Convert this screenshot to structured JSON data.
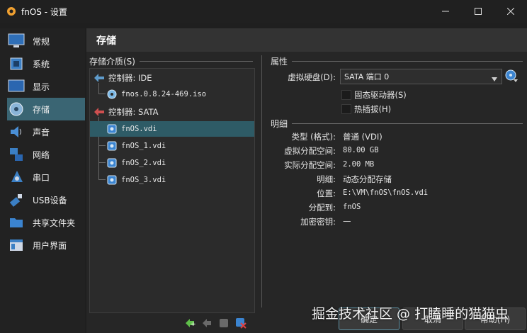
{
  "window": {
    "title": "fnOS - 设置"
  },
  "sidebar": {
    "items": [
      {
        "label": "常规"
      },
      {
        "label": "系统"
      },
      {
        "label": "显示"
      },
      {
        "label": "存储"
      },
      {
        "label": "声音"
      },
      {
        "label": "网络"
      },
      {
        "label": "串口"
      },
      {
        "label": "USB设备"
      },
      {
        "label": "共享文件夹"
      },
      {
        "label": "用户界面"
      }
    ],
    "selected": "存储"
  },
  "page": {
    "title": "存储"
  },
  "storage_tree": {
    "title": "存储介质(S)",
    "controllers": [
      {
        "label": "控制器: IDE",
        "items": [
          {
            "label": "fnos.0.8.24-469.iso"
          }
        ]
      },
      {
        "label": "控制器: SATA",
        "items": [
          {
            "label": "fnOS.vdi"
          },
          {
            "label": "fnOS_1.vdi"
          },
          {
            "label": "fnOS_2.vdi"
          },
          {
            "label": "fnOS_3.vdi"
          }
        ]
      }
    ],
    "selected": "fnOS.vdi"
  },
  "attributes": {
    "title": "属性",
    "hard_disk_label": "虚拟硬盘(D):",
    "hard_disk_value": "SATA 端口 0",
    "solid_state_label": "固态驱动器(S)",
    "solid_state_checked": false,
    "hot_plug_label": "热插拔(H)",
    "hot_plug_checked": false
  },
  "details": {
    "title": "明细",
    "rows": [
      {
        "label": "类型 (格式):",
        "value": "普通 (VDI)"
      },
      {
        "label": "虚拟分配空间:",
        "value": "80.00 GB"
      },
      {
        "label": "实际分配空间:",
        "value": "2.00 MB"
      },
      {
        "label": "明细:",
        "value": "动态分配存储"
      },
      {
        "label": "位置:",
        "value": "E:\\VM\\fnOS\\fnOS.vdi"
      },
      {
        "label": "分配到:",
        "value": "fnOS"
      },
      {
        "label": "加密密钥:",
        "value": "—"
      }
    ]
  },
  "footer": {
    "ok_label": "确定",
    "cancel_label": "取消",
    "help_label": "帮助(H)"
  },
  "watermark": "掘金技术社区 @ 打瞌睡的猫猫虫",
  "colors": {
    "selected_sidebar": "#3a6573",
    "selected_tree": "#2e5b66",
    "background": "#1f1f1f"
  }
}
